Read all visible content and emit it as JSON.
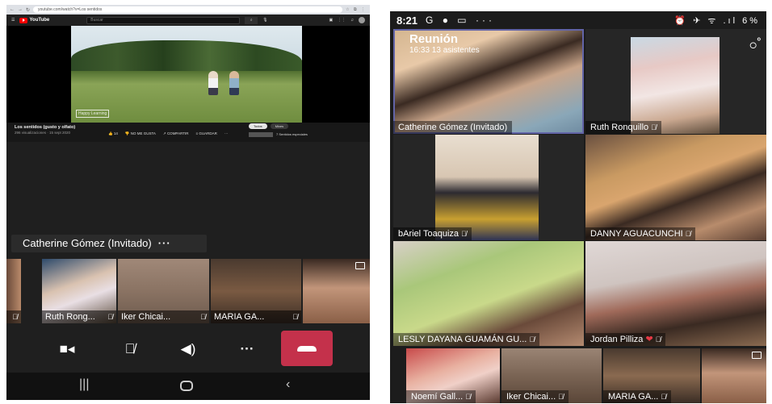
{
  "left": {
    "browser": {
      "url": "youtube.com/watch?v=Los sentidos",
      "search_placeholder": "Buscar",
      "youtube_logo": "YouTube"
    },
    "video": {
      "title": "Los sentidos (gusto y olfato)",
      "meta": "296 visualizaciones · 15 sept 2020",
      "watermark": "Happy Learning",
      "actions": {
        "likes": "14",
        "dislike": "NO ME GUSTA",
        "share": "COMPARTIR",
        "save": "GUARDAR",
        "more": "···"
      },
      "chips": [
        "Todos",
        "Mixes"
      ],
      "related_title": "7 Sentidos especiales"
    },
    "speaker_name": "Catherine Gómez (Invitado)",
    "speaker_more": "···",
    "participants": [
      {
        "name": "",
        "mic_off": true
      },
      {
        "name": "Ruth Rong...",
        "mic_off": true
      },
      {
        "name": "Iker Chicai...",
        "mic_off": true
      },
      {
        "name": "MARIA GA...",
        "mic_off": true
      },
      {
        "name": "",
        "mic_off": false
      }
    ],
    "colors": {
      "end_call": "#c4314b",
      "accent": "#6264a7"
    }
  },
  "right": {
    "status": {
      "time": "8:21",
      "apps": "G ● ▭ ···",
      "right_icons": "⏰ ✈ ᯤ .ıl 6%"
    },
    "meeting": {
      "title": "Reunión",
      "subtitle": "16:33  13 asistentes"
    },
    "tiles": [
      {
        "name": "Catherine Gómez (Invitado)",
        "mic_off": false,
        "heart": false
      },
      {
        "name": "Ruth Ronquillo",
        "mic_off": true,
        "heart": false
      },
      {
        "name": "bAriel Toaquiza",
        "mic_off": true,
        "heart": false
      },
      {
        "name": "DANNY AGUACUNCHI",
        "mic_off": true,
        "heart": false
      },
      {
        "name": "LESLY DAYANA GUAMÁN GU...",
        "mic_off": true,
        "heart": false
      },
      {
        "name": "Jordan Pilliza",
        "mic_off": true,
        "heart": true
      }
    ],
    "bottom_strip": [
      {
        "name": "Noemí Gall...",
        "mic_off": true
      },
      {
        "name": "Iker Chicai...",
        "mic_off": true
      },
      {
        "name": "MARIA GA...",
        "mic_off": true
      },
      {
        "name": "",
        "mic_off": false
      }
    ]
  }
}
